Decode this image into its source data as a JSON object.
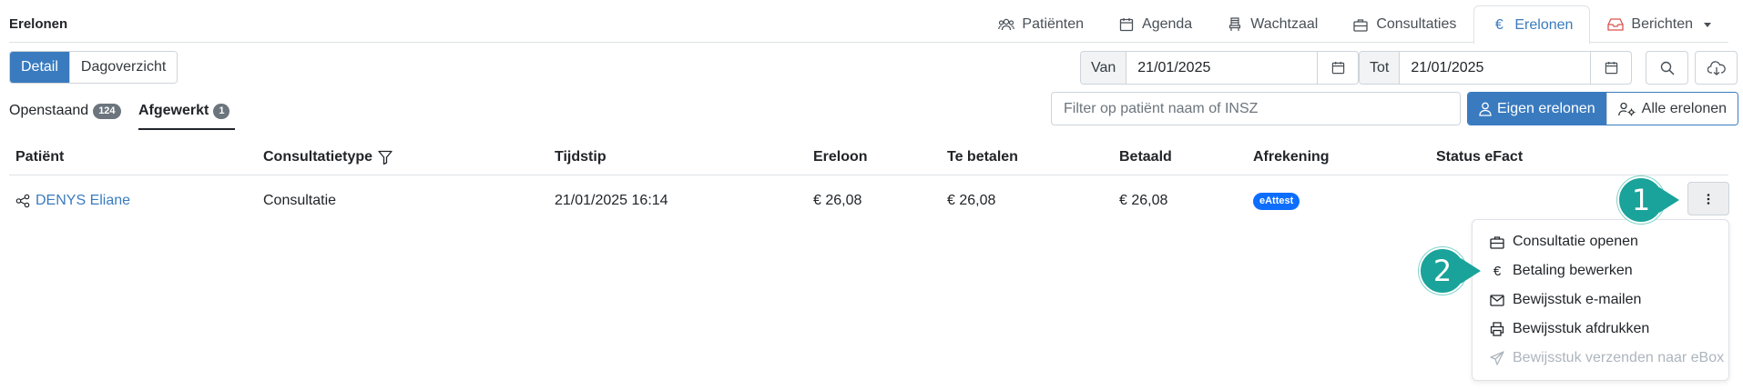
{
  "header": {
    "title": "Erelonen"
  },
  "nav": {
    "tabs": [
      {
        "label": "Patiënten",
        "icon": "users-icon",
        "active": false
      },
      {
        "label": "Agenda",
        "icon": "calendar-icon",
        "active": false
      },
      {
        "label": "Wachtzaal",
        "icon": "chair-icon",
        "active": false
      },
      {
        "label": "Consultaties",
        "icon": "briefcase-icon",
        "active": false
      },
      {
        "label": "Erelonen",
        "icon": "euro-icon",
        "active": true
      },
      {
        "label": "Berichten",
        "icon": "inbox-icon",
        "active": false
      }
    ],
    "accent": "#3a7bbf"
  },
  "view_toggle": {
    "detail": "Detail",
    "dagoverzicht": "Dagoverzicht"
  },
  "date_range": {
    "from_label": "Van",
    "from_value": "21/01/2025",
    "to_label": "Tot",
    "to_value": "21/01/2025"
  },
  "status_tabs": {
    "openstaand": {
      "label": "Openstaand",
      "count": "124"
    },
    "afgewerkt": {
      "label": "Afgewerkt",
      "count": "1"
    }
  },
  "filter": {
    "placeholder": "Filter op patiënt naam of INSZ"
  },
  "fee_toggle": {
    "own": "Eigen erelonen",
    "all": "Alle erelonen"
  },
  "table": {
    "headers": {
      "patient": "Patiënt",
      "type": "Consultatietype",
      "time": "Tijdstip",
      "fee": "Ereloon",
      "to_pay": "Te betalen",
      "paid": "Betaald",
      "settlement": "Afrekening",
      "efact": "Status eFact"
    },
    "rows": [
      {
        "patient": "DENYS Eliane",
        "type": "Consultatie",
        "time": "21/01/2025 16:14",
        "fee": "€ 26,08",
        "to_pay": "€ 26,08",
        "paid": "€ 26,08",
        "settlement": "eAttest",
        "efact": ""
      }
    ]
  },
  "row_menu": {
    "items": [
      {
        "label": "Consultatie openen",
        "icon": "briefcase-icon"
      },
      {
        "label": "Betaling bewerken",
        "icon": "euro-icon"
      },
      {
        "label": "Bewijsstuk e-mailen",
        "icon": "envelope-icon"
      },
      {
        "label": "Bewijsstuk afdrukken",
        "icon": "printer-icon"
      },
      {
        "label": "Bewijsstuk verzenden naar eBox",
        "icon": "send-icon",
        "disabled": true
      }
    ]
  },
  "callouts": {
    "one": "1",
    "two": "2",
    "color": "#1aa39a"
  }
}
